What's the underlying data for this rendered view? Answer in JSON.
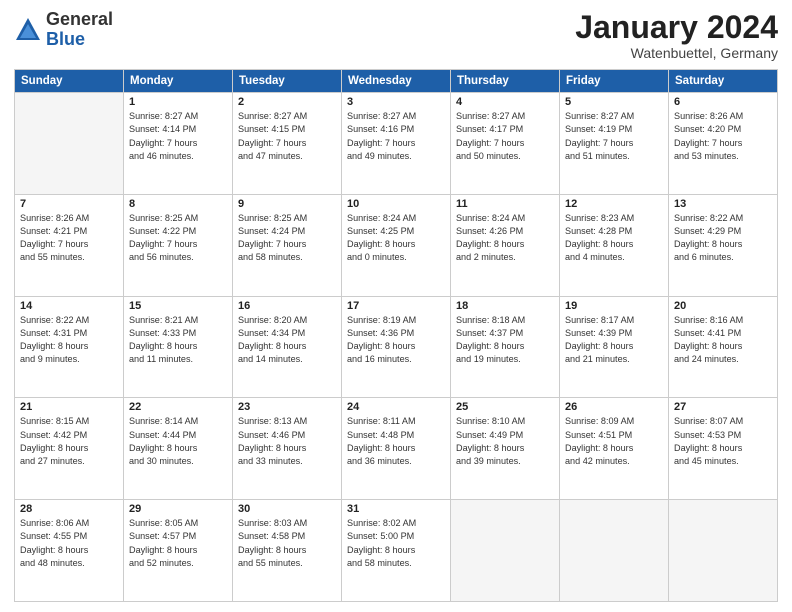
{
  "header": {
    "logo_general": "General",
    "logo_blue": "Blue",
    "month_title": "January 2024",
    "location": "Watenbuettel, Germany"
  },
  "days_of_week": [
    "Sunday",
    "Monday",
    "Tuesday",
    "Wednesday",
    "Thursday",
    "Friday",
    "Saturday"
  ],
  "weeks": [
    [
      {
        "day": "",
        "info": ""
      },
      {
        "day": "1",
        "info": "Sunrise: 8:27 AM\nSunset: 4:14 PM\nDaylight: 7 hours\nand 46 minutes."
      },
      {
        "day": "2",
        "info": "Sunrise: 8:27 AM\nSunset: 4:15 PM\nDaylight: 7 hours\nand 47 minutes."
      },
      {
        "day": "3",
        "info": "Sunrise: 8:27 AM\nSunset: 4:16 PM\nDaylight: 7 hours\nand 49 minutes."
      },
      {
        "day": "4",
        "info": "Sunrise: 8:27 AM\nSunset: 4:17 PM\nDaylight: 7 hours\nand 50 minutes."
      },
      {
        "day": "5",
        "info": "Sunrise: 8:27 AM\nSunset: 4:19 PM\nDaylight: 7 hours\nand 51 minutes."
      },
      {
        "day": "6",
        "info": "Sunrise: 8:26 AM\nSunset: 4:20 PM\nDaylight: 7 hours\nand 53 minutes."
      }
    ],
    [
      {
        "day": "7",
        "info": "Sunrise: 8:26 AM\nSunset: 4:21 PM\nDaylight: 7 hours\nand 55 minutes."
      },
      {
        "day": "8",
        "info": "Sunrise: 8:25 AM\nSunset: 4:22 PM\nDaylight: 7 hours\nand 56 minutes."
      },
      {
        "day": "9",
        "info": "Sunrise: 8:25 AM\nSunset: 4:24 PM\nDaylight: 7 hours\nand 58 minutes."
      },
      {
        "day": "10",
        "info": "Sunrise: 8:24 AM\nSunset: 4:25 PM\nDaylight: 8 hours\nand 0 minutes."
      },
      {
        "day": "11",
        "info": "Sunrise: 8:24 AM\nSunset: 4:26 PM\nDaylight: 8 hours\nand 2 minutes."
      },
      {
        "day": "12",
        "info": "Sunrise: 8:23 AM\nSunset: 4:28 PM\nDaylight: 8 hours\nand 4 minutes."
      },
      {
        "day": "13",
        "info": "Sunrise: 8:22 AM\nSunset: 4:29 PM\nDaylight: 8 hours\nand 6 minutes."
      }
    ],
    [
      {
        "day": "14",
        "info": "Sunrise: 8:22 AM\nSunset: 4:31 PM\nDaylight: 8 hours\nand 9 minutes."
      },
      {
        "day": "15",
        "info": "Sunrise: 8:21 AM\nSunset: 4:33 PM\nDaylight: 8 hours\nand 11 minutes."
      },
      {
        "day": "16",
        "info": "Sunrise: 8:20 AM\nSunset: 4:34 PM\nDaylight: 8 hours\nand 14 minutes."
      },
      {
        "day": "17",
        "info": "Sunrise: 8:19 AM\nSunset: 4:36 PM\nDaylight: 8 hours\nand 16 minutes."
      },
      {
        "day": "18",
        "info": "Sunrise: 8:18 AM\nSunset: 4:37 PM\nDaylight: 8 hours\nand 19 minutes."
      },
      {
        "day": "19",
        "info": "Sunrise: 8:17 AM\nSunset: 4:39 PM\nDaylight: 8 hours\nand 21 minutes."
      },
      {
        "day": "20",
        "info": "Sunrise: 8:16 AM\nSunset: 4:41 PM\nDaylight: 8 hours\nand 24 minutes."
      }
    ],
    [
      {
        "day": "21",
        "info": "Sunrise: 8:15 AM\nSunset: 4:42 PM\nDaylight: 8 hours\nand 27 minutes."
      },
      {
        "day": "22",
        "info": "Sunrise: 8:14 AM\nSunset: 4:44 PM\nDaylight: 8 hours\nand 30 minutes."
      },
      {
        "day": "23",
        "info": "Sunrise: 8:13 AM\nSunset: 4:46 PM\nDaylight: 8 hours\nand 33 minutes."
      },
      {
        "day": "24",
        "info": "Sunrise: 8:11 AM\nSunset: 4:48 PM\nDaylight: 8 hours\nand 36 minutes."
      },
      {
        "day": "25",
        "info": "Sunrise: 8:10 AM\nSunset: 4:49 PM\nDaylight: 8 hours\nand 39 minutes."
      },
      {
        "day": "26",
        "info": "Sunrise: 8:09 AM\nSunset: 4:51 PM\nDaylight: 8 hours\nand 42 minutes."
      },
      {
        "day": "27",
        "info": "Sunrise: 8:07 AM\nSunset: 4:53 PM\nDaylight: 8 hours\nand 45 minutes."
      }
    ],
    [
      {
        "day": "28",
        "info": "Sunrise: 8:06 AM\nSunset: 4:55 PM\nDaylight: 8 hours\nand 48 minutes."
      },
      {
        "day": "29",
        "info": "Sunrise: 8:05 AM\nSunset: 4:57 PM\nDaylight: 8 hours\nand 52 minutes."
      },
      {
        "day": "30",
        "info": "Sunrise: 8:03 AM\nSunset: 4:58 PM\nDaylight: 8 hours\nand 55 minutes."
      },
      {
        "day": "31",
        "info": "Sunrise: 8:02 AM\nSunset: 5:00 PM\nDaylight: 8 hours\nand 58 minutes."
      },
      {
        "day": "",
        "info": ""
      },
      {
        "day": "",
        "info": ""
      },
      {
        "day": "",
        "info": ""
      }
    ]
  ]
}
